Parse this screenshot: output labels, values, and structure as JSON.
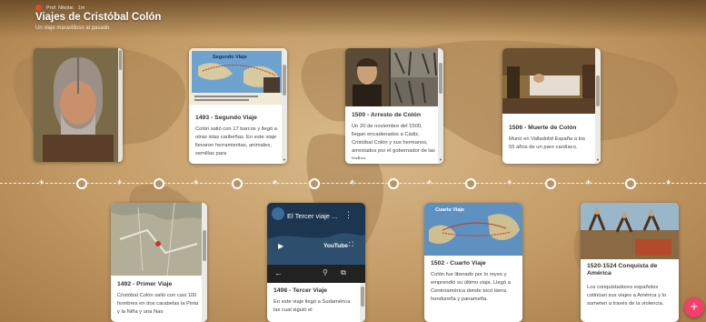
{
  "header": {
    "author": "Prof. Nikolai",
    "time": "1m",
    "title": "Viajes de Cristóbal Colón",
    "subtitle": "Un viaje maravilloso al pasado"
  },
  "cards_top": [
    {
      "title": "1493 - Segundo Viaje",
      "text": "Colón salió con 17 barcos y llegó a otras islas caribeñas. En este viaje llevaron herramientas, animales, semillas para",
      "image_caption": "Segundo Viaje"
    },
    {
      "title": "1500 - Arresto de Colón",
      "text": "Un 20 de noviembre del 1500, llegan encadenados a Cádiz, Cristóbal Colón y sus hermanos, arrestados por el gobernador de las Indias"
    },
    {
      "title": "1506 - Muerte de Colón",
      "text": "Murió en Valladolid España a los 55 años de un paro cardíaco."
    }
  ],
  "cards_bottom": [
    {
      "title": "1492 - Primer Viaje",
      "text": "Cristóbal Colón salió con casi 100 hombres en dos carabelas la Pinta y la Niña y una Nao"
    },
    {
      "title": "1498 - Tercer Viaje",
      "text": "En este viaje llegó a Sudamérica las cual siguió el",
      "video_title": "El Tercer viaje ...",
      "video_brand": "YouTube"
    },
    {
      "title": "1502 - Cuarto Viaje",
      "text": "Colón fue liberado por lo reyes y emprendió su último viaje. Llegó a Centroamérica donde tocó tierra hondureña y panameña.",
      "image_caption": "Cuarto Viaje"
    },
    {
      "title": "1520-1524 Conquista de América",
      "text": "Los conquistadores españoles cotinúan sus viajes a América y lo someten a través de la violencia."
    }
  ],
  "colors": {
    "fab": "#f2406b",
    "background": "#c39b66"
  },
  "fab_label": "+",
  "timeline_plus": "+"
}
